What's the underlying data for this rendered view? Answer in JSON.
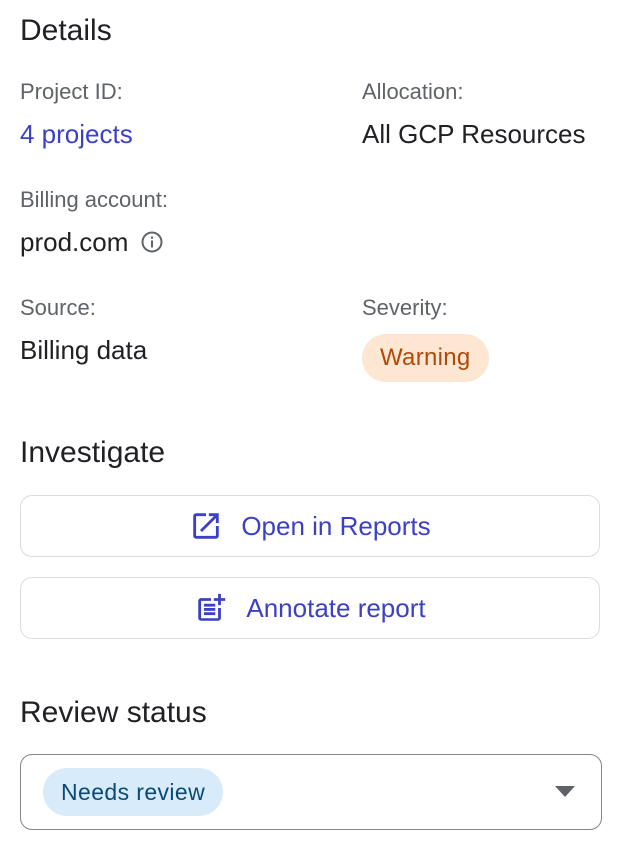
{
  "details": {
    "title": "Details",
    "project_id": {
      "label": "Project ID:",
      "value": "4 projects"
    },
    "allocation": {
      "label": "Allocation:",
      "value": "All GCP Resources"
    },
    "billing_account": {
      "label": "Billing account:",
      "value": "prod.com",
      "icon": "info-icon"
    },
    "source": {
      "label": "Source:",
      "value": "Billing data"
    },
    "severity": {
      "label": "Severity:",
      "value": "Warning",
      "color": "#b04a08",
      "background": "#fde6d2"
    }
  },
  "investigate": {
    "title": "Investigate",
    "open_reports": {
      "label": "Open in Reports",
      "icon": "open-in-new-icon"
    },
    "annotate_report": {
      "label": "Annotate report",
      "icon": "post-add-icon"
    }
  },
  "review_status": {
    "title": "Review status",
    "selected": "Needs review",
    "chip_color": "#0b4a74",
    "chip_background": "#d7ebfb"
  },
  "colors": {
    "accent": "#3c40c6",
    "label_text": "#5f6368",
    "primary_text": "#202124",
    "border": "#dadce0"
  }
}
